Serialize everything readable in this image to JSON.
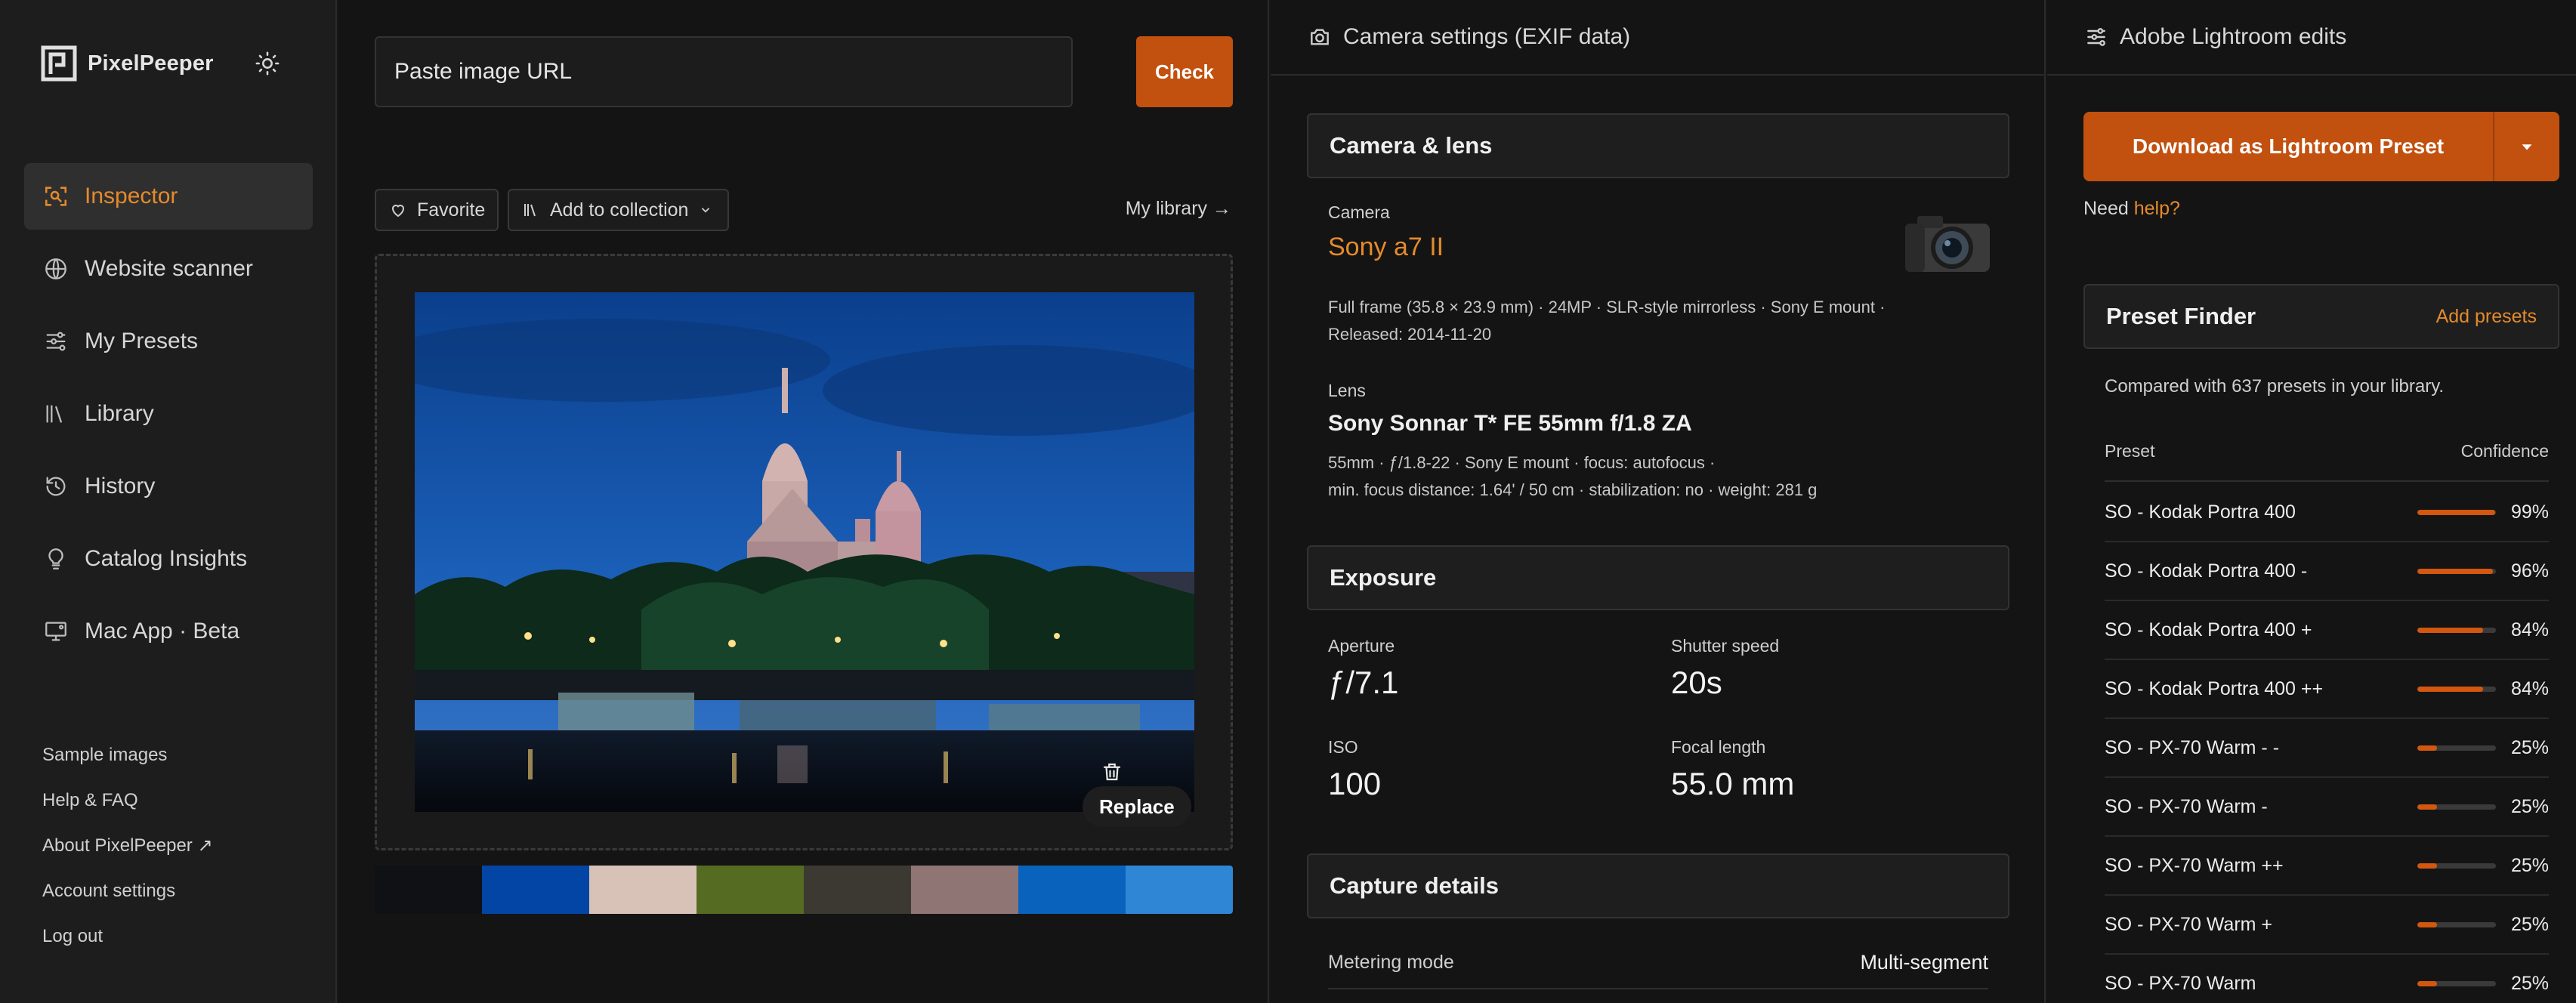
{
  "brand": {
    "name": "PixelPeeper"
  },
  "sidebar": {
    "nav": [
      {
        "label": "Inspector",
        "icon": "inspector-icon",
        "active": true
      },
      {
        "label": "Website scanner",
        "icon": "globe-icon",
        "active": false
      },
      {
        "label": "My Presets",
        "icon": "sliders-icon",
        "active": false
      },
      {
        "label": "Library",
        "icon": "library-icon",
        "active": false
      },
      {
        "label": "History",
        "icon": "history-icon",
        "active": false
      },
      {
        "label": "Catalog Insights",
        "icon": "lightbulb-icon",
        "active": false
      },
      {
        "label": "Mac App · Beta",
        "icon": "desktop-icon",
        "active": false
      }
    ],
    "footer": [
      "Sample images",
      "Help & FAQ",
      "About PixelPeeper ↗",
      "Account settings",
      "Log out"
    ]
  },
  "inspector": {
    "url_placeholder": "Paste image URL",
    "check_label": "Check",
    "favorite_label": "Favorite",
    "collection_label": "Add to collection",
    "library_link": "My library →",
    "replace_label": "Replace",
    "swatches": [
      "#0f1114",
      "#0345a4",
      "#d8c2b8",
      "#556b22",
      "#3c3933",
      "#8f7674",
      "#0963bd",
      "#2f86d4"
    ]
  },
  "exif": {
    "header": "Camera settings (EXIF data)",
    "camera_section": "Camera & lens",
    "camera_label": "Camera",
    "camera_name": "Sony a7 II",
    "camera_meta_1": "Full frame (35.8 × 23.9 mm)  ·  24MP  ·  SLR-style mirrorless  ·  Sony E mount  ·",
    "camera_meta_2": "Released: 2014-11-20",
    "lens_label": "Lens",
    "lens_name": "Sony Sonnar T* FE 55mm f/1.8 ZA",
    "lens_meta_1": "55mm  ·  ƒ/1.8-22  ·  Sony E mount  ·  focus: autofocus  ·",
    "lens_meta_2": "min. focus distance: 1.64' / 50 cm  ·  stabilization: no  ·  weight: 281 g",
    "exposure_section": "Exposure",
    "aperture_label": "Aperture",
    "aperture_value": "ƒ/7.1",
    "shutter_label": "Shutter speed",
    "shutter_value": "20s",
    "iso_label": "ISO",
    "iso_value": "100",
    "focal_label": "Focal length",
    "focal_value": "55.0 mm",
    "capture_section": "Capture details",
    "metering_label": "Metering mode",
    "metering_value": "Multi-segment"
  },
  "lightroom": {
    "header": "Adobe Lightroom edits",
    "download_label": "Download as Lightroom Preset",
    "help_prefix": "Need ",
    "help_link": "help?",
    "finder_title": "Preset Finder",
    "add_presets": "Add presets",
    "compared_text": "Compared with 637 presets in your library.",
    "col_preset": "Preset",
    "col_confidence": "Confidence",
    "presets": [
      {
        "name": "SO - Kodak Portra 400",
        "confidence": "99%",
        "fill": 0.99
      },
      {
        "name": "SO - Kodak Portra 400 -",
        "confidence": "96%",
        "fill": 0.96
      },
      {
        "name": "SO - Kodak Portra 400 +",
        "confidence": "84%",
        "fill": 0.84
      },
      {
        "name": "SO - Kodak Portra 400 ++",
        "confidence": "84%",
        "fill": 0.84
      },
      {
        "name": "SO - PX-70 Warm - -",
        "confidence": "25%",
        "fill": 0.25
      },
      {
        "name": "SO - PX-70 Warm -",
        "confidence": "25%",
        "fill": 0.25
      },
      {
        "name": "SO - PX-70 Warm ++",
        "confidence": "25%",
        "fill": 0.25
      },
      {
        "name": "SO - PX-70 Warm +",
        "confidence": "25%",
        "fill": 0.25
      },
      {
        "name": "SO - PX-70 Warm",
        "confidence": "25%",
        "fill": 0.25
      }
    ]
  }
}
